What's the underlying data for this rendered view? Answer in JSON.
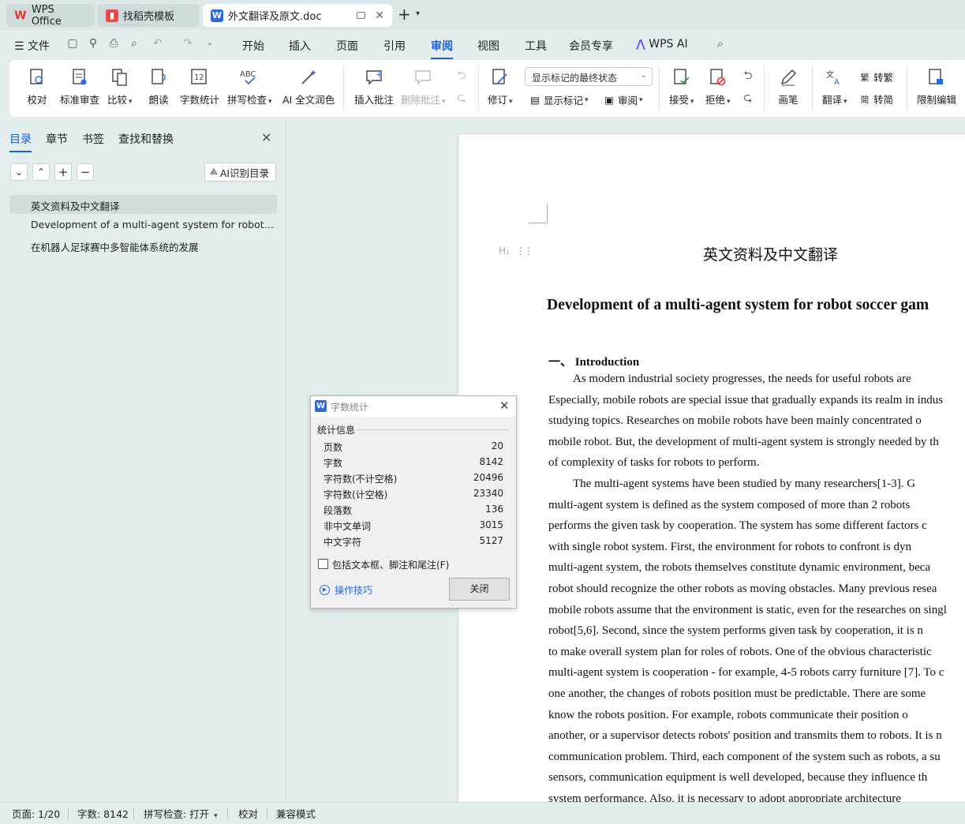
{
  "tabs": {
    "wps": "WPS Office",
    "template": "找稻壳模板",
    "doc": "外文翻译及原文.doc"
  },
  "menu": {
    "file": "文件",
    "items": [
      "开始",
      "插入",
      "页面",
      "引用",
      "审阅",
      "视图",
      "工具",
      "会员专享"
    ],
    "wps_ai": "WPS AI"
  },
  "ribbon": {
    "proofread": "校对",
    "std_review": "标准审查",
    "compare": "比较",
    "read_aloud": "朗读",
    "word_count": "字数统计",
    "spell_check": "拼写检查",
    "ai_polish": "AI 全文润色",
    "insert_comment": "插入批注",
    "delete_comment": "删除批注",
    "revision": "修订",
    "markup_select": "显示标记的最终状态",
    "show_markup": "显示标记",
    "review": "审阅",
    "accept": "接受",
    "reject": "拒绝",
    "pen": "画笔",
    "translate": "翻译",
    "to_traditional": "转繁",
    "to_simplified": "转简",
    "restrict_edit": "限制编辑"
  },
  "left_panel": {
    "tabs": [
      "目录",
      "章节",
      "书签",
      "查找和替换"
    ],
    "ai_toc": "AI识别目录",
    "toc": [
      "英文资料及中文翻译",
      "Development of a multi-agent system for robot so…",
      "在机器人足球赛中多智能体系统的发展"
    ]
  },
  "document": {
    "heading_mark": "H₁",
    "title": "英文资料及中文翻译",
    "subtitle": "Development of a multi-agent system for robot soccer gam",
    "section": "一、 Introduction",
    "lines": [
      "As modern industrial society progresses, the needs for useful robots are",
      "Especially, mobile robots are special issue that gradually expands its realm in indus",
      "studying topics. Researches on mobile robots have been mainly concentrated o",
      "mobile robot. But, the development of multi-agent system is strongly needed by th",
      "of complexity of tasks for robots to perform.",
      "The multi-agent systems have been studied by many researchers[1-3]. G",
      "multi-agent system is defined as the system composed of more than 2 robots",
      "performs the given task by cooperation. The system has some different factors c",
      "with single robot system. First, the environment for robots to confront is dyn",
      "multi-agent system, the robots themselves constitute dynamic environment, beca",
      "robot should recognize the other robots as moving obstacles. Many previous resea",
      "mobile robots assume that the environment is static, even for the researches on singl",
      "robot[5,6]. Second, since the system performs given task by cooperation, it is n",
      "to make overall system plan for roles of robots. One of the obvious characteristic",
      "multi-agent system is cooperation - for example, 4-5 robots carry furniture [7]. To c",
      "one another, the changes of robots position must be predictable. There are some",
      "know the robots position. For example, robots communicate their position o",
      "another, or a supervisor detects robots' position and transmits them to robots. It is n",
      "communication problem. Third, each component of the system such as robots, a su",
      "sensors, communication equipment is well developed, because they influence th",
      "system performance. Also, it is necessary to adopt appropriate architecture"
    ]
  },
  "dialog": {
    "title": "字数统计",
    "group": "统计信息",
    "stats": [
      {
        "label": "页数",
        "value": "20"
      },
      {
        "label": "字数",
        "value": "8142"
      },
      {
        "label": "字符数(不计空格)",
        "value": "20496"
      },
      {
        "label": "字符数(计空格)",
        "value": "23340"
      },
      {
        "label": "段落数",
        "value": "136"
      },
      {
        "label": "非中文单词",
        "value": "3015"
      },
      {
        "label": "中文字符",
        "value": "5127"
      }
    ],
    "checkbox": "包括文本框、脚注和尾注(F)",
    "tips": "操作技巧",
    "close": "关闭"
  },
  "status": {
    "page": "页面: 1/20",
    "words": "字数: 8142",
    "spell": "拼写检查: 打开",
    "proof": "校对",
    "compat": "兼容模式"
  }
}
